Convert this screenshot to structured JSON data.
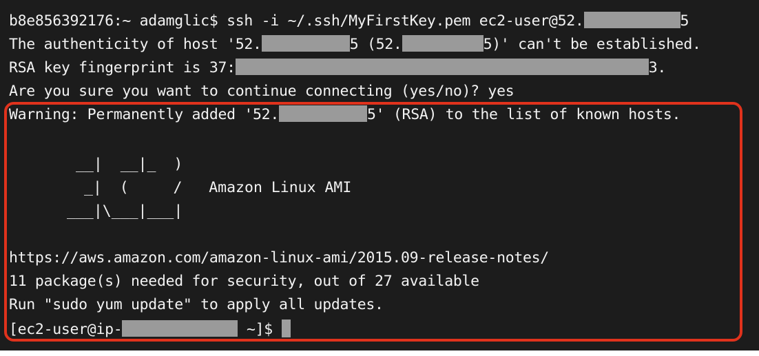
{
  "terminal": {
    "colors": {
      "background": "#1c1c1c",
      "text": "#f2f2f2",
      "redaction": "#9a9a9a",
      "highlight_border": "#e0321c"
    },
    "lines": {
      "l1_a": "b8e856392176:~ adamglic$ ssh -i ~/.ssh/MyFirstKey.pem ec2-user@52.",
      "l1_b": "5",
      "l2_a": "The authenticity of host '52.",
      "l2_b": "5 (52.",
      "l2_c": "5)' can't be established.",
      "l3_a": "RSA key fingerprint is 37:",
      "l3_b": "3.",
      "l4": "Are you sure you want to continue connecting (yes/no)? yes",
      "l5_a": "Warning: Permanently added '52.",
      "l5_b": "5' (RSA) to the list of known hosts.",
      "banner_1": "__|  __|_  )",
      "banner_2": "_|  (     /   Amazon Linux AMI",
      "banner_3": "___|\\___|___|",
      "l9": "https://aws.amazon.com/amazon-linux-ami/2015.09-release-notes/",
      "l10": "11 package(s) needed for security, out of 27 available",
      "l11": "Run \"sudo yum update\" to apply all updates.",
      "prompt_a": "[ec2-user@ip-",
      "prompt_b": " ~]$ "
    }
  }
}
